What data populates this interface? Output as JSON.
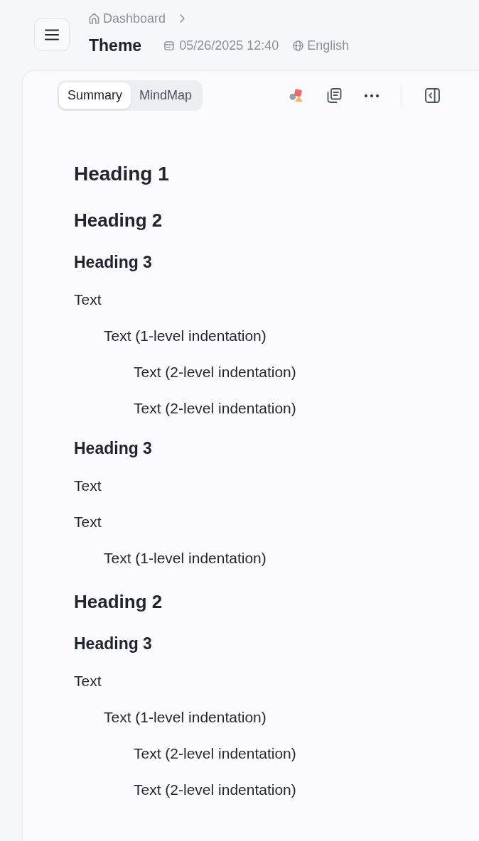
{
  "header": {
    "breadcrumb": [
      {
        "label": "Dashboard"
      }
    ],
    "title": "Theme",
    "date": "05/26/2025 12:40",
    "language": "English"
  },
  "view_tabs": [
    {
      "label": "Summary",
      "selected": true
    },
    {
      "label": "MindMap",
      "selected": false
    }
  ],
  "outline": [
    {
      "kind": "heading1",
      "text": "Heading 1",
      "children": [
        {
          "kind": "heading2",
          "text": "Heading 2",
          "children": [
            {
              "kind": "heading3",
              "text": "Heading 3",
              "children": [
                {
                  "kind": "text",
                  "text": "Text",
                  "children": [
                    {
                      "kind": "text",
                      "text": "Text (1-level indentation)",
                      "children": [
                        {
                          "kind": "text",
                          "text": "Text (2-level indentation)"
                        },
                        {
                          "kind": "text",
                          "text": "Text (2-level indentation)"
                        }
                      ]
                    }
                  ]
                }
              ]
            },
            {
              "kind": "heading3",
              "text": "Heading 3",
              "children": [
                {
                  "kind": "text",
                  "text": "Text"
                },
                {
                  "kind": "text",
                  "text": "Text",
                  "children": [
                    {
                      "kind": "text",
                      "text": "Text (1-level indentation)"
                    }
                  ]
                }
              ]
            }
          ]
        },
        {
          "kind": "heading2",
          "text": "Heading 2",
          "children": [
            {
              "kind": "heading3",
              "text": "Heading 3",
              "children": [
                {
                  "kind": "text",
                  "text": "Text",
                  "children": [
                    {
                      "kind": "text",
                      "text": "Text (1-level indentation)",
                      "children": [
                        {
                          "kind": "text",
                          "text": "Text (2-level indentation)"
                        },
                        {
                          "kind": "text",
                          "text": "Text (2-level indentation)"
                        }
                      ]
                    }
                  ]
                }
              ]
            }
          ]
        }
      ]
    }
  ]
}
